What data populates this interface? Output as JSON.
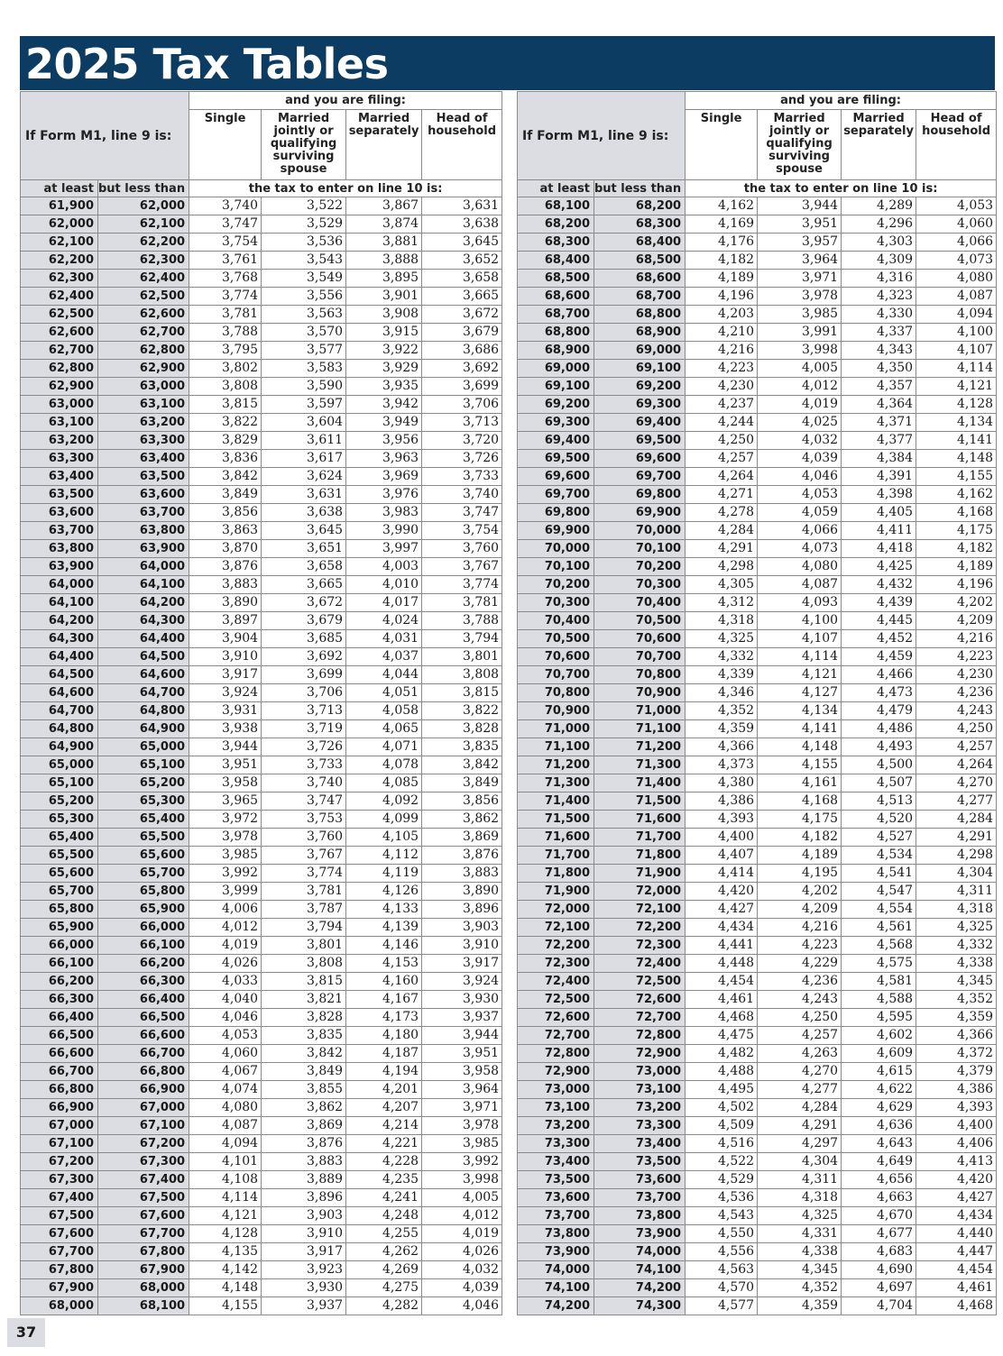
{
  "title": "2025 Tax Tables",
  "page_number": "37",
  "header": {
    "row_label": "If Form M1, line 9 is:",
    "filing_label": "and you are filing:",
    "columns": [
      "Single",
      "Married jointly or qualifying surviving spouse",
      "Married separately",
      "Head of household"
    ],
    "at_least": "at least",
    "but_less_than": "but less than",
    "tax_label": "the tax to enter on line 10 is:"
  },
  "left": {
    "rows": [
      [
        "61,900",
        "62,000",
        "3,740",
        "3,522",
        "3,867",
        "3,631"
      ],
      [
        "62,000",
        "62,100",
        "3,747",
        "3,529",
        "3,874",
        "3,638"
      ],
      [
        "62,100",
        "62,200",
        "3,754",
        "3,536",
        "3,881",
        "3,645"
      ],
      [
        "62,200",
        "62,300",
        "3,761",
        "3,543",
        "3,888",
        "3,652"
      ],
      [
        "62,300",
        "62,400",
        "3,768",
        "3,549",
        "3,895",
        "3,658"
      ],
      [
        "62,400",
        "62,500",
        "3,774",
        "3,556",
        "3,901",
        "3,665"
      ],
      [
        "62,500",
        "62,600",
        "3,781",
        "3,563",
        "3,908",
        "3,672"
      ],
      [
        "62,600",
        "62,700",
        "3,788",
        "3,570",
        "3,915",
        "3,679"
      ],
      [
        "62,700",
        "62,800",
        "3,795",
        "3,577",
        "3,922",
        "3,686"
      ],
      [
        "62,800",
        "62,900",
        "3,802",
        "3,583",
        "3,929",
        "3,692"
      ],
      [
        "62,900",
        "63,000",
        "3,808",
        "3,590",
        "3,935",
        "3,699"
      ],
      [
        "63,000",
        "63,100",
        "3,815",
        "3,597",
        "3,942",
        "3,706"
      ],
      [
        "63,100",
        "63,200",
        "3,822",
        "3,604",
        "3,949",
        "3,713"
      ],
      [
        "63,200",
        "63,300",
        "3,829",
        "3,611",
        "3,956",
        "3,720"
      ],
      [
        "63,300",
        "63,400",
        "3,836",
        "3,617",
        "3,963",
        "3,726"
      ],
      [
        "63,400",
        "63,500",
        "3,842",
        "3,624",
        "3,969",
        "3,733"
      ],
      [
        "63,500",
        "63,600",
        "3,849",
        "3,631",
        "3,976",
        "3,740"
      ],
      [
        "63,600",
        "63,700",
        "3,856",
        "3,638",
        "3,983",
        "3,747"
      ],
      [
        "63,700",
        "63,800",
        "3,863",
        "3,645",
        "3,990",
        "3,754"
      ],
      [
        "63,800",
        "63,900",
        "3,870",
        "3,651",
        "3,997",
        "3,760"
      ],
      [
        "63,900",
        "64,000",
        "3,876",
        "3,658",
        "4,003",
        "3,767"
      ],
      [
        "64,000",
        "64,100",
        "3,883",
        "3,665",
        "4,010",
        "3,774"
      ],
      [
        "64,100",
        "64,200",
        "3,890",
        "3,672",
        "4,017",
        "3,781"
      ],
      [
        "64,200",
        "64,300",
        "3,897",
        "3,679",
        "4,024",
        "3,788"
      ],
      [
        "64,300",
        "64,400",
        "3,904",
        "3,685",
        "4,031",
        "3,794"
      ],
      [
        "64,400",
        "64,500",
        "3,910",
        "3,692",
        "4,037",
        "3,801"
      ],
      [
        "64,500",
        "64,600",
        "3,917",
        "3,699",
        "4,044",
        "3,808"
      ],
      [
        "64,600",
        "64,700",
        "3,924",
        "3,706",
        "4,051",
        "3,815"
      ],
      [
        "64,700",
        "64,800",
        "3,931",
        "3,713",
        "4,058",
        "3,822"
      ],
      [
        "64,800",
        "64,900",
        "3,938",
        "3,719",
        "4,065",
        "3,828"
      ],
      [
        "64,900",
        "65,000",
        "3,944",
        "3,726",
        "4,071",
        "3,835"
      ],
      [
        "65,000",
        "65,100",
        "3,951",
        "3,733",
        "4,078",
        "3,842"
      ],
      [
        "65,100",
        "65,200",
        "3,958",
        "3,740",
        "4,085",
        "3,849"
      ],
      [
        "65,200",
        "65,300",
        "3,965",
        "3,747",
        "4,092",
        "3,856"
      ],
      [
        "65,300",
        "65,400",
        "3,972",
        "3,753",
        "4,099",
        "3,862"
      ],
      [
        "65,400",
        "65,500",
        "3,978",
        "3,760",
        "4,105",
        "3,869"
      ],
      [
        "65,500",
        "65,600",
        "3,985",
        "3,767",
        "4,112",
        "3,876"
      ],
      [
        "65,600",
        "65,700",
        "3,992",
        "3,774",
        "4,119",
        "3,883"
      ],
      [
        "65,700",
        "65,800",
        "3,999",
        "3,781",
        "4,126",
        "3,890"
      ],
      [
        "65,800",
        "65,900",
        "4,006",
        "3,787",
        "4,133",
        "3,896"
      ],
      [
        "65,900",
        "66,000",
        "4,012",
        "3,794",
        "4,139",
        "3,903"
      ],
      [
        "66,000",
        "66,100",
        "4,019",
        "3,801",
        "4,146",
        "3,910"
      ],
      [
        "66,100",
        "66,200",
        "4,026",
        "3,808",
        "4,153",
        "3,917"
      ],
      [
        "66,200",
        "66,300",
        "4,033",
        "3,815",
        "4,160",
        "3,924"
      ],
      [
        "66,300",
        "66,400",
        "4,040",
        "3,821",
        "4,167",
        "3,930"
      ],
      [
        "66,400",
        "66,500",
        "4,046",
        "3,828",
        "4,173",
        "3,937"
      ],
      [
        "66,500",
        "66,600",
        "4,053",
        "3,835",
        "4,180",
        "3,944"
      ],
      [
        "66,600",
        "66,700",
        "4,060",
        "3,842",
        "4,187",
        "3,951"
      ],
      [
        "66,700",
        "66,800",
        "4,067",
        "3,849",
        "4,194",
        "3,958"
      ],
      [
        "66,800",
        "66,900",
        "4,074",
        "3,855",
        "4,201",
        "3,964"
      ],
      [
        "66,900",
        "67,000",
        "4,080",
        "3,862",
        "4,207",
        "3,971"
      ],
      [
        "67,000",
        "67,100",
        "4,087",
        "3,869",
        "4,214",
        "3,978"
      ],
      [
        "67,100",
        "67,200",
        "4,094",
        "3,876",
        "4,221",
        "3,985"
      ],
      [
        "67,200",
        "67,300",
        "4,101",
        "3,883",
        "4,228",
        "3,992"
      ],
      [
        "67,300",
        "67,400",
        "4,108",
        "3,889",
        "4,235",
        "3,998"
      ],
      [
        "67,400",
        "67,500",
        "4,114",
        "3,896",
        "4,241",
        "4,005"
      ],
      [
        "67,500",
        "67,600",
        "4,121",
        "3,903",
        "4,248",
        "4,012"
      ],
      [
        "67,600",
        "67,700",
        "4,128",
        "3,910",
        "4,255",
        "4,019"
      ],
      [
        "67,700",
        "67,800",
        "4,135",
        "3,917",
        "4,262",
        "4,026"
      ],
      [
        "67,800",
        "67,900",
        "4,142",
        "3,923",
        "4,269",
        "4,032"
      ],
      [
        "67,900",
        "68,000",
        "4,148",
        "3,930",
        "4,275",
        "4,039"
      ],
      [
        "68,000",
        "68,100",
        "4,155",
        "3,937",
        "4,282",
        "4,046"
      ]
    ]
  },
  "right": {
    "rows": [
      [
        "68,100",
        "68,200",
        "4,162",
        "3,944",
        "4,289",
        "4,053"
      ],
      [
        "68,200",
        "68,300",
        "4,169",
        "3,951",
        "4,296",
        "4,060"
      ],
      [
        "68,300",
        "68,400",
        "4,176",
        "3,957",
        "4,303",
        "4,066"
      ],
      [
        "68,400",
        "68,500",
        "4,182",
        "3,964",
        "4,309",
        "4,073"
      ],
      [
        "68,500",
        "68,600",
        "4,189",
        "3,971",
        "4,316",
        "4,080"
      ],
      [
        "68,600",
        "68,700",
        "4,196",
        "3,978",
        "4,323",
        "4,087"
      ],
      [
        "68,700",
        "68,800",
        "4,203",
        "3,985",
        "4,330",
        "4,094"
      ],
      [
        "68,800",
        "68,900",
        "4,210",
        "3,991",
        "4,337",
        "4,100"
      ],
      [
        "68,900",
        "69,000",
        "4,216",
        "3,998",
        "4,343",
        "4,107"
      ],
      [
        "69,000",
        "69,100",
        "4,223",
        "4,005",
        "4,350",
        "4,114"
      ],
      [
        "69,100",
        "69,200",
        "4,230",
        "4,012",
        "4,357",
        "4,121"
      ],
      [
        "69,200",
        "69,300",
        "4,237",
        "4,019",
        "4,364",
        "4,128"
      ],
      [
        "69,300",
        "69,400",
        "4,244",
        "4,025",
        "4,371",
        "4,134"
      ],
      [
        "69,400",
        "69,500",
        "4,250",
        "4,032",
        "4,377",
        "4,141"
      ],
      [
        "69,500",
        "69,600",
        "4,257",
        "4,039",
        "4,384",
        "4,148"
      ],
      [
        "69,600",
        "69,700",
        "4,264",
        "4,046",
        "4,391",
        "4,155"
      ],
      [
        "69,700",
        "69,800",
        "4,271",
        "4,053",
        "4,398",
        "4,162"
      ],
      [
        "69,800",
        "69,900",
        "4,278",
        "4,059",
        "4,405",
        "4,168"
      ],
      [
        "69,900",
        "70,000",
        "4,284",
        "4,066",
        "4,411",
        "4,175"
      ],
      [
        "70,000",
        "70,100",
        "4,291",
        "4,073",
        "4,418",
        "4,182"
      ],
      [
        "70,100",
        "70,200",
        "4,298",
        "4,080",
        "4,425",
        "4,189"
      ],
      [
        "70,200",
        "70,300",
        "4,305",
        "4,087",
        "4,432",
        "4,196"
      ],
      [
        "70,300",
        "70,400",
        "4,312",
        "4,093",
        "4,439",
        "4,202"
      ],
      [
        "70,400",
        "70,500",
        "4,318",
        "4,100",
        "4,445",
        "4,209"
      ],
      [
        "70,500",
        "70,600",
        "4,325",
        "4,107",
        "4,452",
        "4,216"
      ],
      [
        "70,600",
        "70,700",
        "4,332",
        "4,114",
        "4,459",
        "4,223"
      ],
      [
        "70,700",
        "70,800",
        "4,339",
        "4,121",
        "4,466",
        "4,230"
      ],
      [
        "70,800",
        "70,900",
        "4,346",
        "4,127",
        "4,473",
        "4,236"
      ],
      [
        "70,900",
        "71,000",
        "4,352",
        "4,134",
        "4,479",
        "4,243"
      ],
      [
        "71,000",
        "71,100",
        "4,359",
        "4,141",
        "4,486",
        "4,250"
      ],
      [
        "71,100",
        "71,200",
        "4,366",
        "4,148",
        "4,493",
        "4,257"
      ],
      [
        "71,200",
        "71,300",
        "4,373",
        "4,155",
        "4,500",
        "4,264"
      ],
      [
        "71,300",
        "71,400",
        "4,380",
        "4,161",
        "4,507",
        "4,270"
      ],
      [
        "71,400",
        "71,500",
        "4,386",
        "4,168",
        "4,513",
        "4,277"
      ],
      [
        "71,500",
        "71,600",
        "4,393",
        "4,175",
        "4,520",
        "4,284"
      ],
      [
        "71,600",
        "71,700",
        "4,400",
        "4,182",
        "4,527",
        "4,291"
      ],
      [
        "71,700",
        "71,800",
        "4,407",
        "4,189",
        "4,534",
        "4,298"
      ],
      [
        "71,800",
        "71,900",
        "4,414",
        "4,195",
        "4,541",
        "4,304"
      ],
      [
        "71,900",
        "72,000",
        "4,420",
        "4,202",
        "4,547",
        "4,311"
      ],
      [
        "72,000",
        "72,100",
        "4,427",
        "4,209",
        "4,554",
        "4,318"
      ],
      [
        "72,100",
        "72,200",
        "4,434",
        "4,216",
        "4,561",
        "4,325"
      ],
      [
        "72,200",
        "72,300",
        "4,441",
        "4,223",
        "4,568",
        "4,332"
      ],
      [
        "72,300",
        "72,400",
        "4,448",
        "4,229",
        "4,575",
        "4,338"
      ],
      [
        "72,400",
        "72,500",
        "4,454",
        "4,236",
        "4,581",
        "4,345"
      ],
      [
        "72,500",
        "72,600",
        "4,461",
        "4,243",
        "4,588",
        "4,352"
      ],
      [
        "72,600",
        "72,700",
        "4,468",
        "4,250",
        "4,595",
        "4,359"
      ],
      [
        "72,700",
        "72,800",
        "4,475",
        "4,257",
        "4,602",
        "4,366"
      ],
      [
        "72,800",
        "72,900",
        "4,482",
        "4,263",
        "4,609",
        "4,372"
      ],
      [
        "72,900",
        "73,000",
        "4,488",
        "4,270",
        "4,615",
        "4,379"
      ],
      [
        "73,000",
        "73,100",
        "4,495",
        "4,277",
        "4,622",
        "4,386"
      ],
      [
        "73,100",
        "73,200",
        "4,502",
        "4,284",
        "4,629",
        "4,393"
      ],
      [
        "73,200",
        "73,300",
        "4,509",
        "4,291",
        "4,636",
        "4,400"
      ],
      [
        "73,300",
        "73,400",
        "4,516",
        "4,297",
        "4,643",
        "4,406"
      ],
      [
        "73,400",
        "73,500",
        "4,522",
        "4,304",
        "4,649",
        "4,413"
      ],
      [
        "73,500",
        "73,600",
        "4,529",
        "4,311",
        "4,656",
        "4,420"
      ],
      [
        "73,600",
        "73,700",
        "4,536",
        "4,318",
        "4,663",
        "4,427"
      ],
      [
        "73,700",
        "73,800",
        "4,543",
        "4,325",
        "4,670",
        "4,434"
      ],
      [
        "73,800",
        "73,900",
        "4,550",
        "4,331",
        "4,677",
        "4,440"
      ],
      [
        "73,900",
        "74,000",
        "4,556",
        "4,338",
        "4,683",
        "4,447"
      ],
      [
        "74,000",
        "74,100",
        "4,563",
        "4,345",
        "4,690",
        "4,454"
      ],
      [
        "74,100",
        "74,200",
        "4,570",
        "4,352",
        "4,697",
        "4,461"
      ],
      [
        "74,200",
        "74,300",
        "4,577",
        "4,359",
        "4,704",
        "4,468"
      ]
    ]
  }
}
